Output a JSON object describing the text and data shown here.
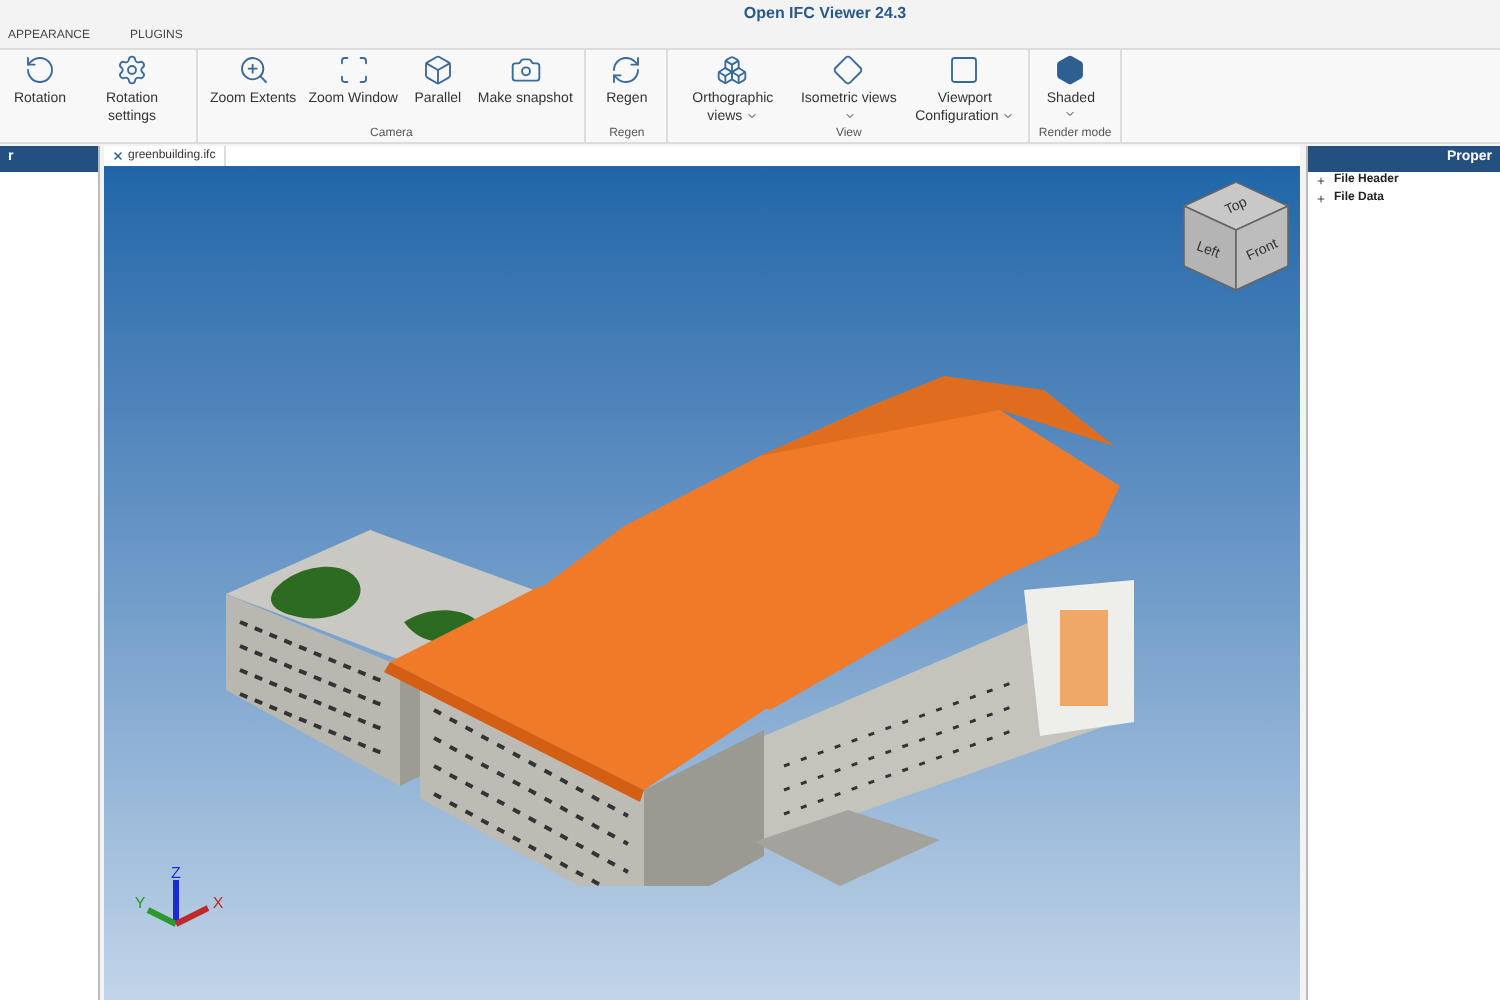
{
  "window": {
    "title": "Open IFC Viewer 24.3"
  },
  "menu_tabs": [
    {
      "label": "APPEARANCE",
      "selected": false
    },
    {
      "label": "PLUGINS",
      "selected": false
    }
  ],
  "ribbon": {
    "groups": [
      {
        "buttons": [
          {
            "label": "Rotation",
            "dropdown": false
          },
          {
            "label": "Rotation settings",
            "dropdown": false
          }
        ]
      },
      {
        "label": "Camera",
        "buttons": [
          {
            "label": "Zoom Extents",
            "dropdown": false
          },
          {
            "label": "Zoom Window",
            "dropdown": false
          },
          {
            "label": "Parallel",
            "dropdown": false
          },
          {
            "label": "Make snapshot",
            "dropdown": false
          }
        ]
      },
      {
        "label": "Regen",
        "buttons": [
          {
            "label": "Regen",
            "dropdown": false
          }
        ]
      },
      {
        "label": "View",
        "buttons": [
          {
            "label": "Orthographic views",
            "dropdown": true
          },
          {
            "label": "Isometric views",
            "dropdown": true
          },
          {
            "label": "Viewport Configuration",
            "dropdown": true
          }
        ]
      },
      {
        "label": "Render mode",
        "buttons": [
          {
            "label": "Shaded",
            "dropdown": true
          }
        ]
      }
    ]
  },
  "left_panel": {
    "title": "r"
  },
  "document_tab": {
    "label": "greenbuilding.ifc"
  },
  "viewport": {
    "nav_cube": {
      "top": "Top",
      "left": "Left",
      "front": "Front"
    },
    "axes": {
      "x": "X",
      "y": "Y",
      "z": "Z"
    }
  },
  "right_panel": {
    "title": "Proper",
    "items": [
      {
        "label": "File Header",
        "expanded": false
      },
      {
        "label": "File Data",
        "expanded": false
      }
    ]
  }
}
